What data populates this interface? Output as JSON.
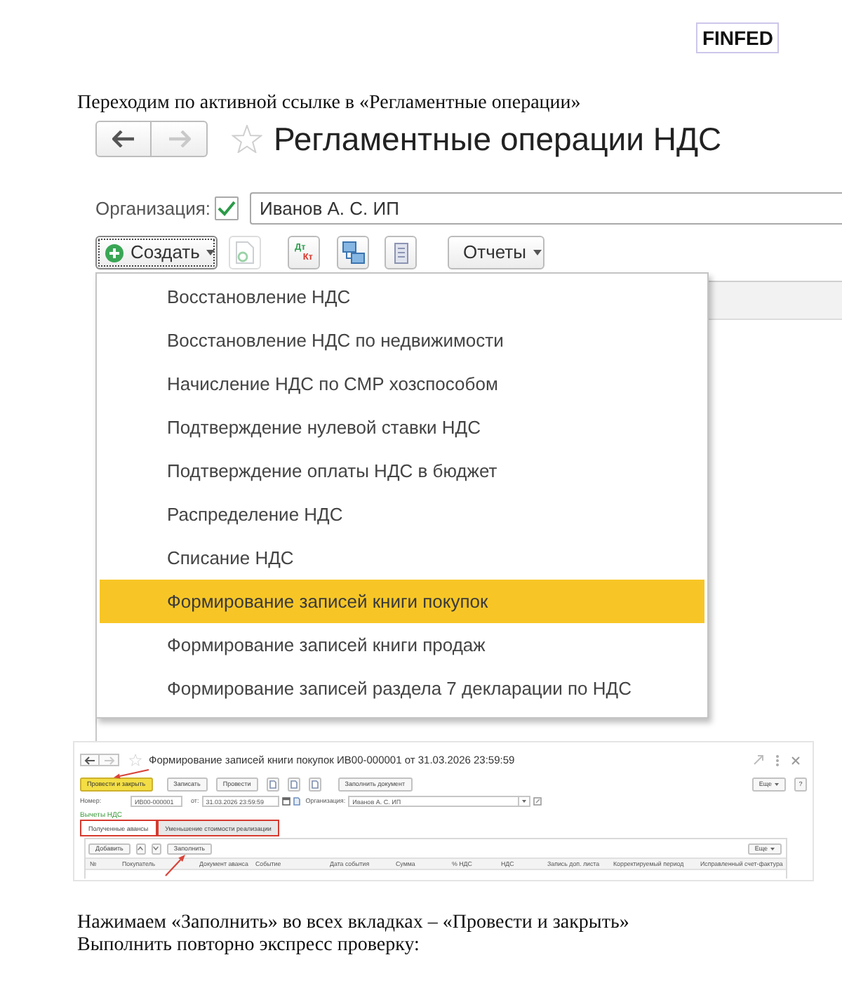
{
  "logo": {
    "text": "FINFED"
  },
  "intro": "Переходим по активной ссылке в «Регламентные операции»",
  "ops_window": {
    "nav": [
      {
        "kind": "back",
        "disabled": false
      },
      {
        "kind": "forward",
        "disabled": true
      }
    ],
    "favorite": false,
    "title": "Регламентные операции НДС",
    "organization": {
      "label": "Организация:",
      "checked": true,
      "value": "Иванов А. С. ИП"
    },
    "toolbar": [
      {
        "kind": "create",
        "label": "Создать",
        "focused": true
      },
      {
        "kind": "document",
        "disabled": true
      },
      {
        "kind": "debit_credit",
        "debit": "Дт",
        "credit": "Кт",
        "disabled": false
      },
      {
        "kind": "structure",
        "disabled": false
      },
      {
        "kind": "list",
        "disabled": false
      },
      {
        "kind": "dropdown",
        "label": "Отчеты"
      }
    ],
    "menu": [
      {
        "label": "Восстановление НДС",
        "selected": false
      },
      {
        "label": "Восстановление НДС по недвижимости",
        "selected": false
      },
      {
        "label": "Начисление НДС по СМР хозспособом",
        "selected": false
      },
      {
        "label": "Подтверждение нулевой ставки НДС",
        "selected": false
      },
      {
        "label": "Подтверждение оплаты НДС в бюджет",
        "selected": false
      },
      {
        "label": "Распределение НДС",
        "selected": false
      },
      {
        "label": "Списание НДС",
        "selected": false
      },
      {
        "label": "Формирование записей книги покупок",
        "selected": true
      },
      {
        "label": "Формирование записей книги продаж",
        "selected": false
      },
      {
        "label": "Формирование записей раздела 7 декларации по НДС",
        "selected": false
      }
    ]
  },
  "doc_window": {
    "nav": [
      {
        "kind": "back",
        "disabled": false
      },
      {
        "kind": "forward",
        "disabled": true
      }
    ],
    "favorite": false,
    "title": "Формирование записей книги покупок ИВ00-000001 от 31.03.2026 23:59:59",
    "commands": [
      {
        "kind": "button",
        "label": "Провести и закрыть",
        "default": true
      },
      {
        "kind": "button",
        "label": "Записать",
        "default": false
      },
      {
        "kind": "button",
        "label": "Провести",
        "default": false
      },
      {
        "kind": "icon"
      },
      {
        "kind": "icon"
      },
      {
        "kind": "icon"
      },
      {
        "kind": "button",
        "label": "Заполнить документ",
        "default": false
      }
    ],
    "more": "Еще",
    "help": "?",
    "fields": [
      {
        "kind": "text",
        "label": "Номер:",
        "value": "ИВ00-000001"
      },
      {
        "kind": "date",
        "label": "от:",
        "value": "31.03.2026 23:59:59"
      },
      {
        "kind": "select",
        "label": "Организация:",
        "value": "Иванов А. С. ИП"
      }
    ],
    "section": "Вычеты НДС",
    "tabs": [
      {
        "label": "Полученные авансы",
        "selected": true,
        "marked": true
      },
      {
        "label": "Уменьшение стоимости реализации",
        "selected": false,
        "marked": true
      }
    ],
    "table_toolbar": [
      {
        "kind": "button",
        "label": "Добавить"
      },
      {
        "kind": "move_up"
      },
      {
        "kind": "move_down"
      },
      {
        "kind": "button",
        "label": "Заполнить"
      }
    ],
    "table_more": "Еще",
    "columns": [
      "№",
      "Покупатель",
      "Документ аванса",
      "Событие",
      "Дата события",
      "Сумма",
      "% НДС",
      "НДС",
      "Запись доп. листа",
      "Корректируемый период",
      "Исправленный счет-фактура"
    ]
  },
  "outro": [
    "Нажимаем «Заполнить» во всех вкладках – «Провести и закрыть»",
    "Выполнить повторно экспресс проверку:"
  ]
}
